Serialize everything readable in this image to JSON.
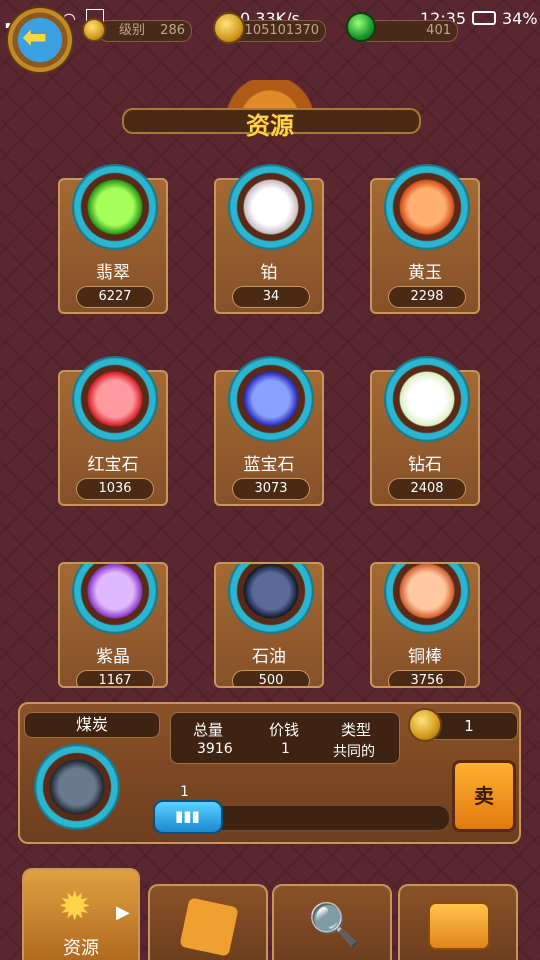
{
  "status_bar": {
    "signal": "2G",
    "speed": "0.33K/s",
    "time": "12:35",
    "battery": "34%"
  },
  "top_bar": {
    "level_label": "级别",
    "level_value": "286",
    "coins": "105101370",
    "gems": "401"
  },
  "title": "资源",
  "resources": [
    {
      "name": "翡翠",
      "value": "6227",
      "c1": "#a6ff5a",
      "c2": "#2a9a1a"
    },
    {
      "name": "铂",
      "value": "34",
      "c1": "#ffffff",
      "c2": "#c9bdc4"
    },
    {
      "name": "黄玉",
      "value": "2298",
      "c1": "#ffb070",
      "c2": "#d0501a"
    },
    {
      "name": "红宝石",
      "value": "1036",
      "c1": "#ff9aa0",
      "c2": "#d8202a"
    },
    {
      "name": "蓝宝石",
      "value": "3073",
      "c1": "#8aa0ff",
      "c2": "#2a2ab8"
    },
    {
      "name": "钻石",
      "value": "2408",
      "c1": "#ffffff",
      "c2": "#d8f0c0"
    },
    {
      "name": "紫晶",
      "value": "1167",
      "c1": "#e0b8ff",
      "c2": "#8a3ac8"
    },
    {
      "name": "石油",
      "value": "500",
      "c1": "#5a6a9a",
      "c2": "#101a30"
    },
    {
      "name": "铜棒",
      "value": "3756",
      "c1": "#ffc8a0",
      "c2": "#d06030"
    }
  ],
  "detail": {
    "name": "煤炭",
    "total_label": "总量",
    "total_value": "3916",
    "price_label": "价钱",
    "price_value": "1",
    "type_label": "类型",
    "type_value": "共同的",
    "sell_amount": "1",
    "sell_label": "卖",
    "slider_value": "1"
  },
  "tabs": {
    "resources_label": "资源"
  },
  "colors": {
    "accent": "#ffd34a",
    "card": "#a36a32",
    "cyan": "#2ab6d0"
  }
}
